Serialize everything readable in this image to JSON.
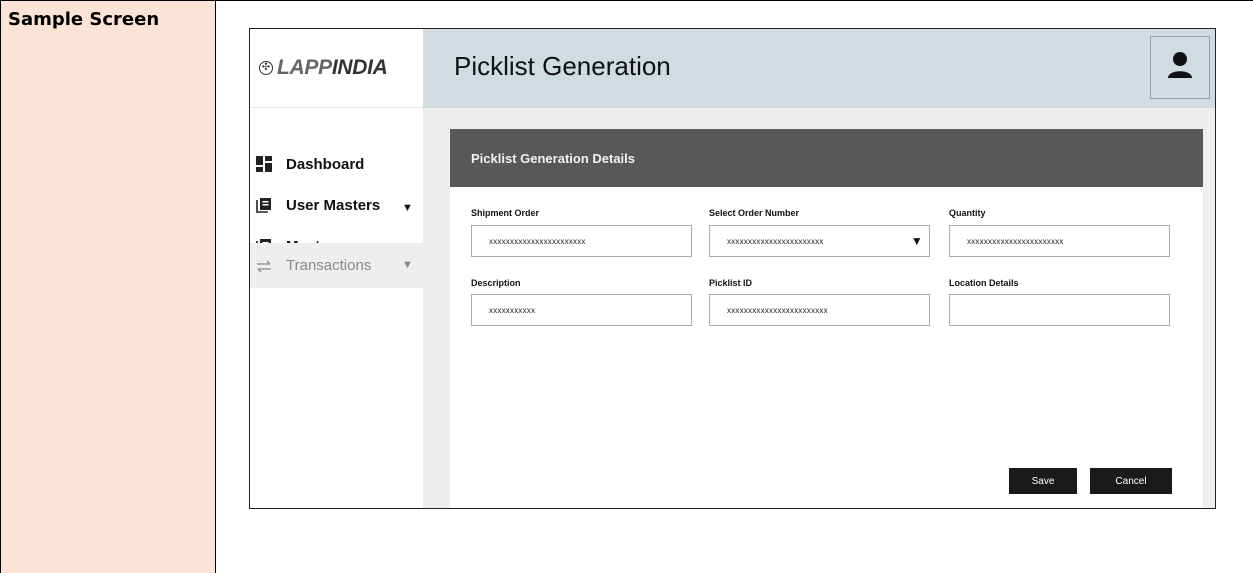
{
  "document": {
    "label": "Sample Screen"
  },
  "brand": {
    "logo_lapp": "LAPP",
    "logo_india": "INDIA"
  },
  "sidebar": {
    "items": [
      {
        "label": "Dashboard",
        "icon": "dashboard-icon"
      },
      {
        "label": "User Masters",
        "icon": "book-icon",
        "caret": "▼"
      },
      {
        "label": "Masters",
        "icon": "book-icon",
        "caret": "▼"
      },
      {
        "label": "Transactions",
        "icon": "swap-arrows-icon",
        "caret": "▼"
      }
    ]
  },
  "header": {
    "title": "Picklist Generation",
    "avatar_icon": "user-icon"
  },
  "card": {
    "title": "Picklist Generation  Details"
  },
  "form": {
    "shipment_order": {
      "label": "Shipment Order",
      "value": "xxxxxxxxxxxxxxxxxxxxxxx"
    },
    "order_number": {
      "label": "Select Order Number",
      "value": "xxxxxxxxxxxxxxxxxxxxxxx",
      "caret": "▼"
    },
    "quantity": {
      "label": "Quantity",
      "value": "xxxxxxxxxxxxxxxxxxxxxxx"
    },
    "description": {
      "label": "Description",
      "value": "xxxxxxxxxxx"
    },
    "picklist_id": {
      "label": "Picklist ID",
      "value": "xxxxxxxxxxxxxxxxxxxxxxxx"
    },
    "location_details": {
      "label": "Location Details",
      "value": ""
    }
  },
  "actions": {
    "save": "Save",
    "cancel": "Cancel"
  },
  "colors": {
    "label_cell_bg": "#fbe4d5",
    "topbar_bg": "#d0dce0",
    "card_header_bg": "#58575a",
    "button_bg": "#1a1a1a"
  }
}
